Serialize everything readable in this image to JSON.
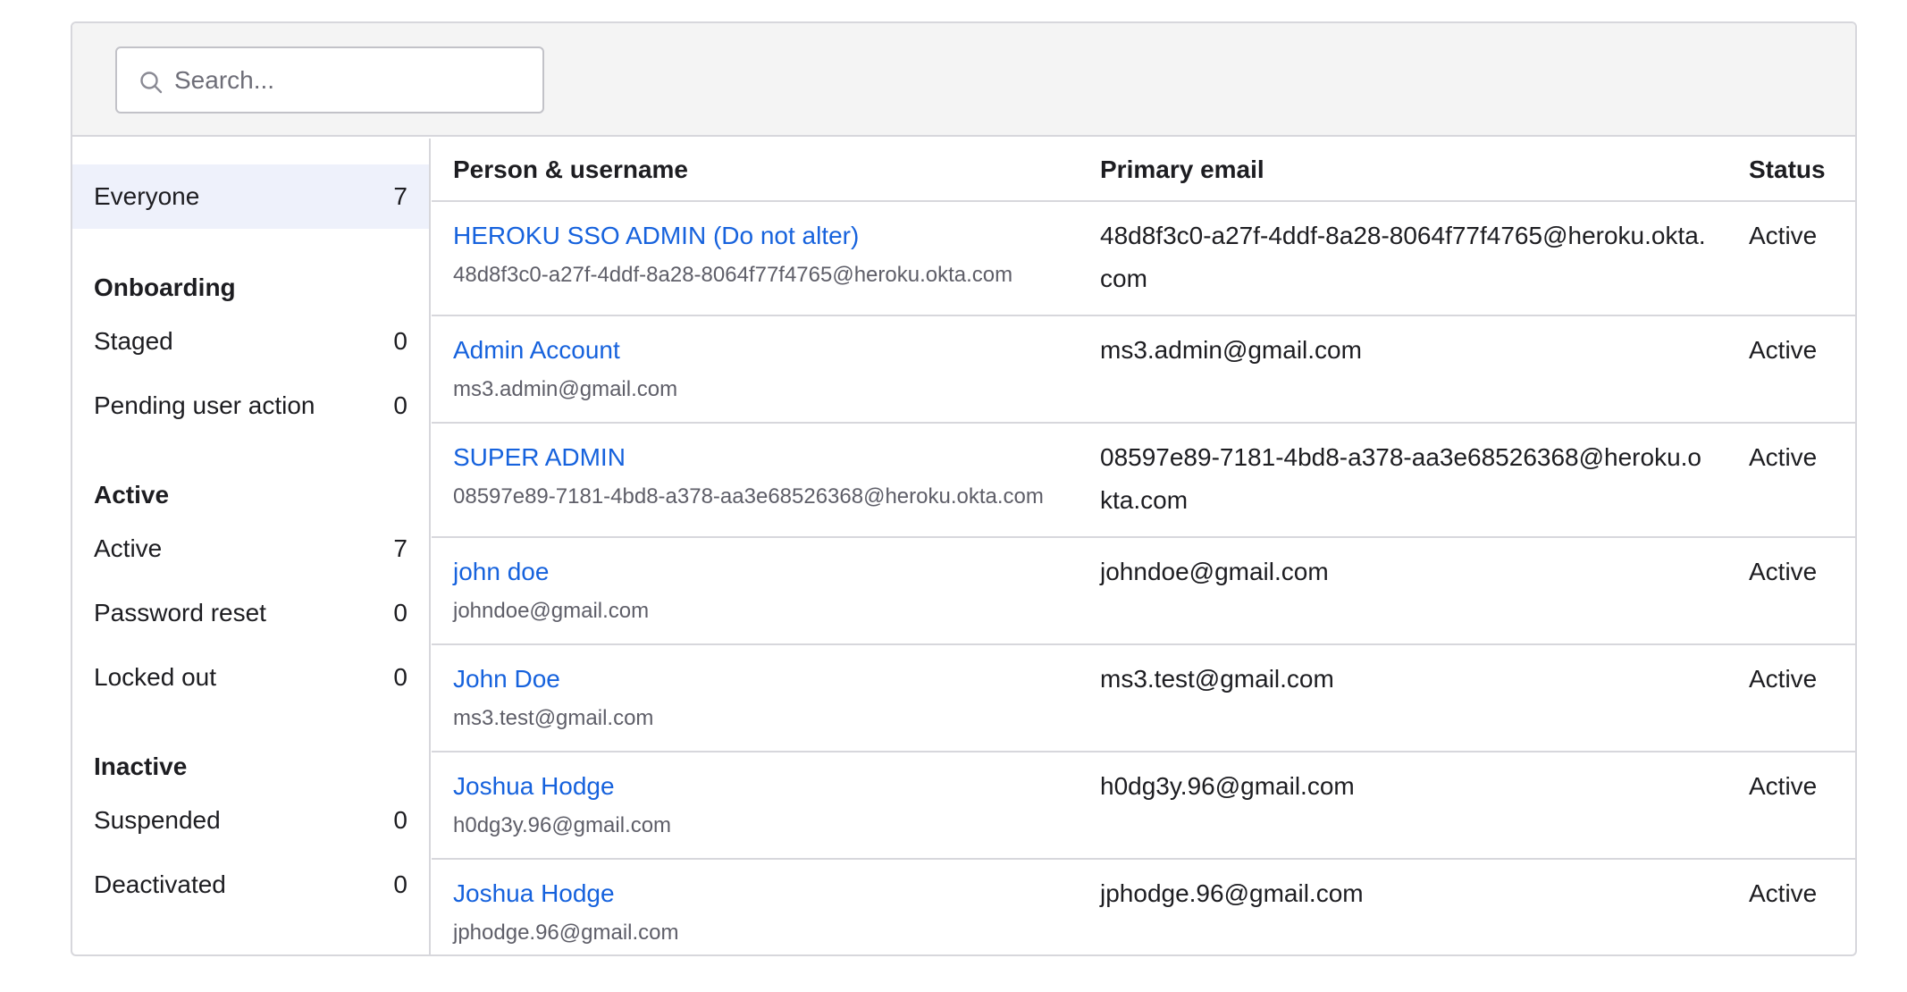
{
  "search": {
    "placeholder": "Search...",
    "value": ""
  },
  "sidebar": {
    "everyone": {
      "label": "Everyone",
      "count": "7"
    },
    "groups": [
      {
        "heading": "Onboarding",
        "items": [
          {
            "label": "Staged",
            "count": "0"
          },
          {
            "label": "Pending user action",
            "count": "0"
          }
        ]
      },
      {
        "heading": "Active",
        "items": [
          {
            "label": "Active",
            "count": "7"
          },
          {
            "label": "Password reset",
            "count": "0"
          },
          {
            "label": "Locked out",
            "count": "0"
          }
        ]
      },
      {
        "heading": "Inactive",
        "items": [
          {
            "label": "Suspended",
            "count": "0"
          },
          {
            "label": "Deactivated",
            "count": "0"
          }
        ]
      }
    ]
  },
  "table": {
    "columns": [
      "Person & username",
      "Primary email",
      "Status"
    ],
    "rows": [
      {
        "name": "HEROKU SSO ADMIN (Do not alter)",
        "username": "48d8f3c0-a27f-4ddf-8a28-8064f77f4765@heroku.okta.com",
        "email": "48d8f3c0-a27f-4ddf-8a28-8064f77f4765@heroku.okta.com",
        "status": "Active"
      },
      {
        "name": "Admin Account",
        "username": "ms3.admin@gmail.com",
        "email": "ms3.admin@gmail.com",
        "status": "Active"
      },
      {
        "name": "SUPER ADMIN",
        "username": "08597e89-7181-4bd8-a378-aa3e68526368@heroku.okta.com",
        "email": "08597e89-7181-4bd8-a378-aa3e68526368@heroku.okta.com",
        "status": "Active"
      },
      {
        "name": "john doe",
        "username": "johndoe@gmail.com",
        "email": "johndoe@gmail.com",
        "status": "Active"
      },
      {
        "name": "John Doe",
        "username": "ms3.test@gmail.com",
        "email": "ms3.test@gmail.com",
        "status": "Active"
      },
      {
        "name": "Joshua Hodge",
        "username": "h0dg3y.96@gmail.com",
        "email": "h0dg3y.96@gmail.com",
        "status": "Active"
      },
      {
        "name": "Joshua Hodge",
        "username": "jphodge.96@gmail.com",
        "email": "jphodge.96@gmail.com",
        "status": "Active"
      }
    ]
  }
}
